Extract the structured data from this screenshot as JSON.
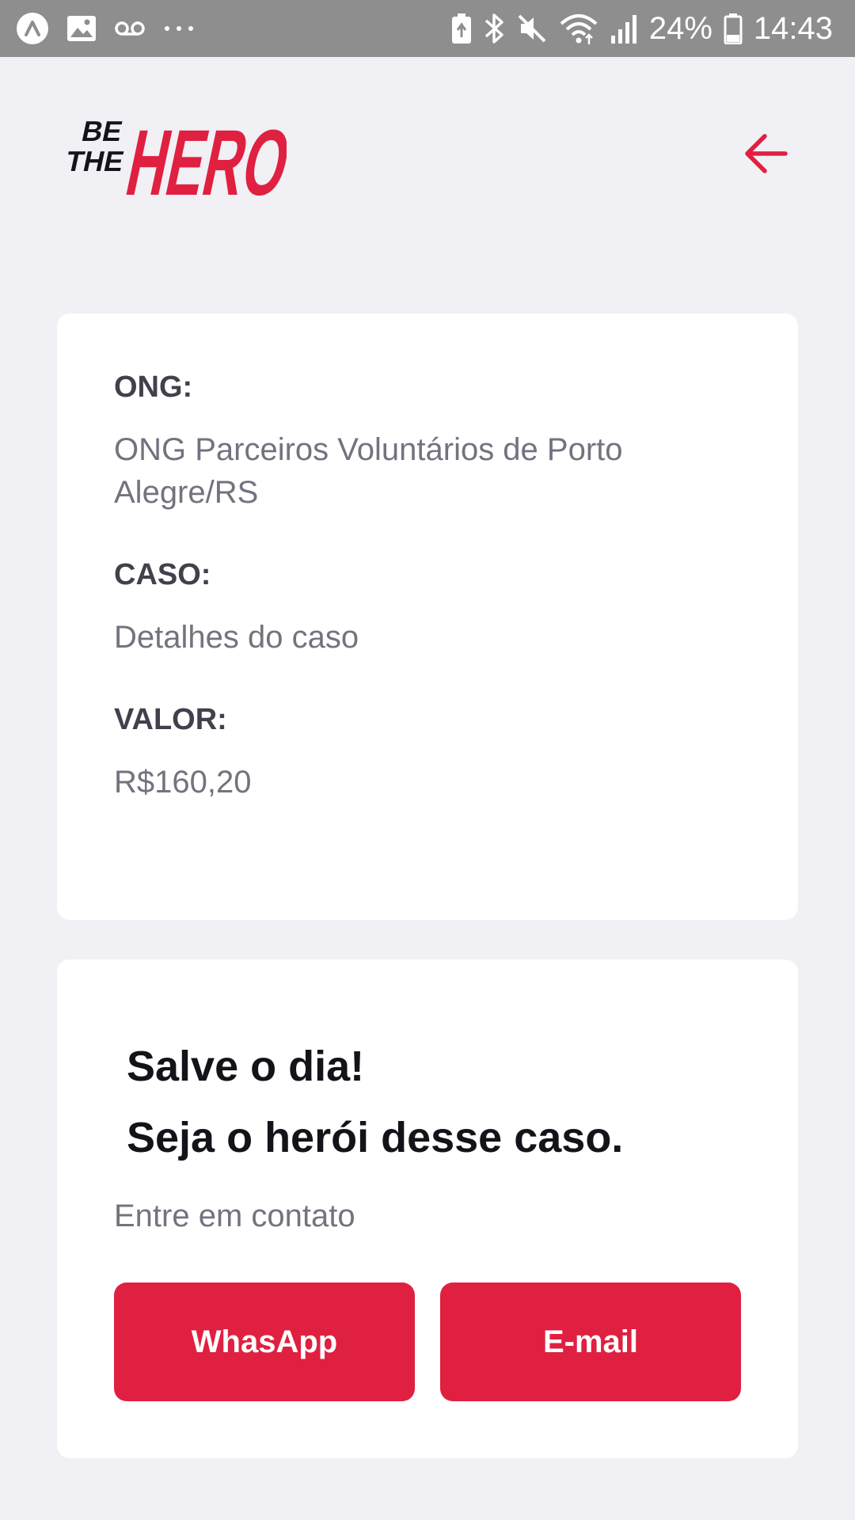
{
  "status_bar": {
    "battery_percent": "24%",
    "time": "14:43",
    "left_icons": [
      "app-icon",
      "image-icon",
      "voicemail-icon",
      "more-dots-icon"
    ],
    "right_icons": [
      "battery-saver-icon",
      "bluetooth-icon",
      "mute-icon",
      "wifi-icon",
      "signal-icon",
      "battery-icon"
    ]
  },
  "header": {
    "logo": {
      "line1": "BE",
      "line2": "THE",
      "word": "HERO"
    },
    "back_icon": "arrow-left-icon"
  },
  "incident": {
    "ong_label": "ONG:",
    "ong_value": "ONG Parceiros Voluntários de Porto Alegre/RS",
    "case_label": "CASO:",
    "case_value": "Detalhes do caso",
    "value_label": "VALOR:",
    "value_value": "R$160,20"
  },
  "contact": {
    "title_line1": "Salve o dia!",
    "title_line2": "Seja o herói desse caso.",
    "description": "Entre em contato",
    "whatsapp_label": "WhasApp",
    "email_label": "E-mail"
  },
  "colors": {
    "accent": "#e02041",
    "background": "#f0f0f5",
    "label": "#41414d",
    "text": "#737380",
    "title": "#13131a",
    "status_bar": "#8e8e8e"
  }
}
